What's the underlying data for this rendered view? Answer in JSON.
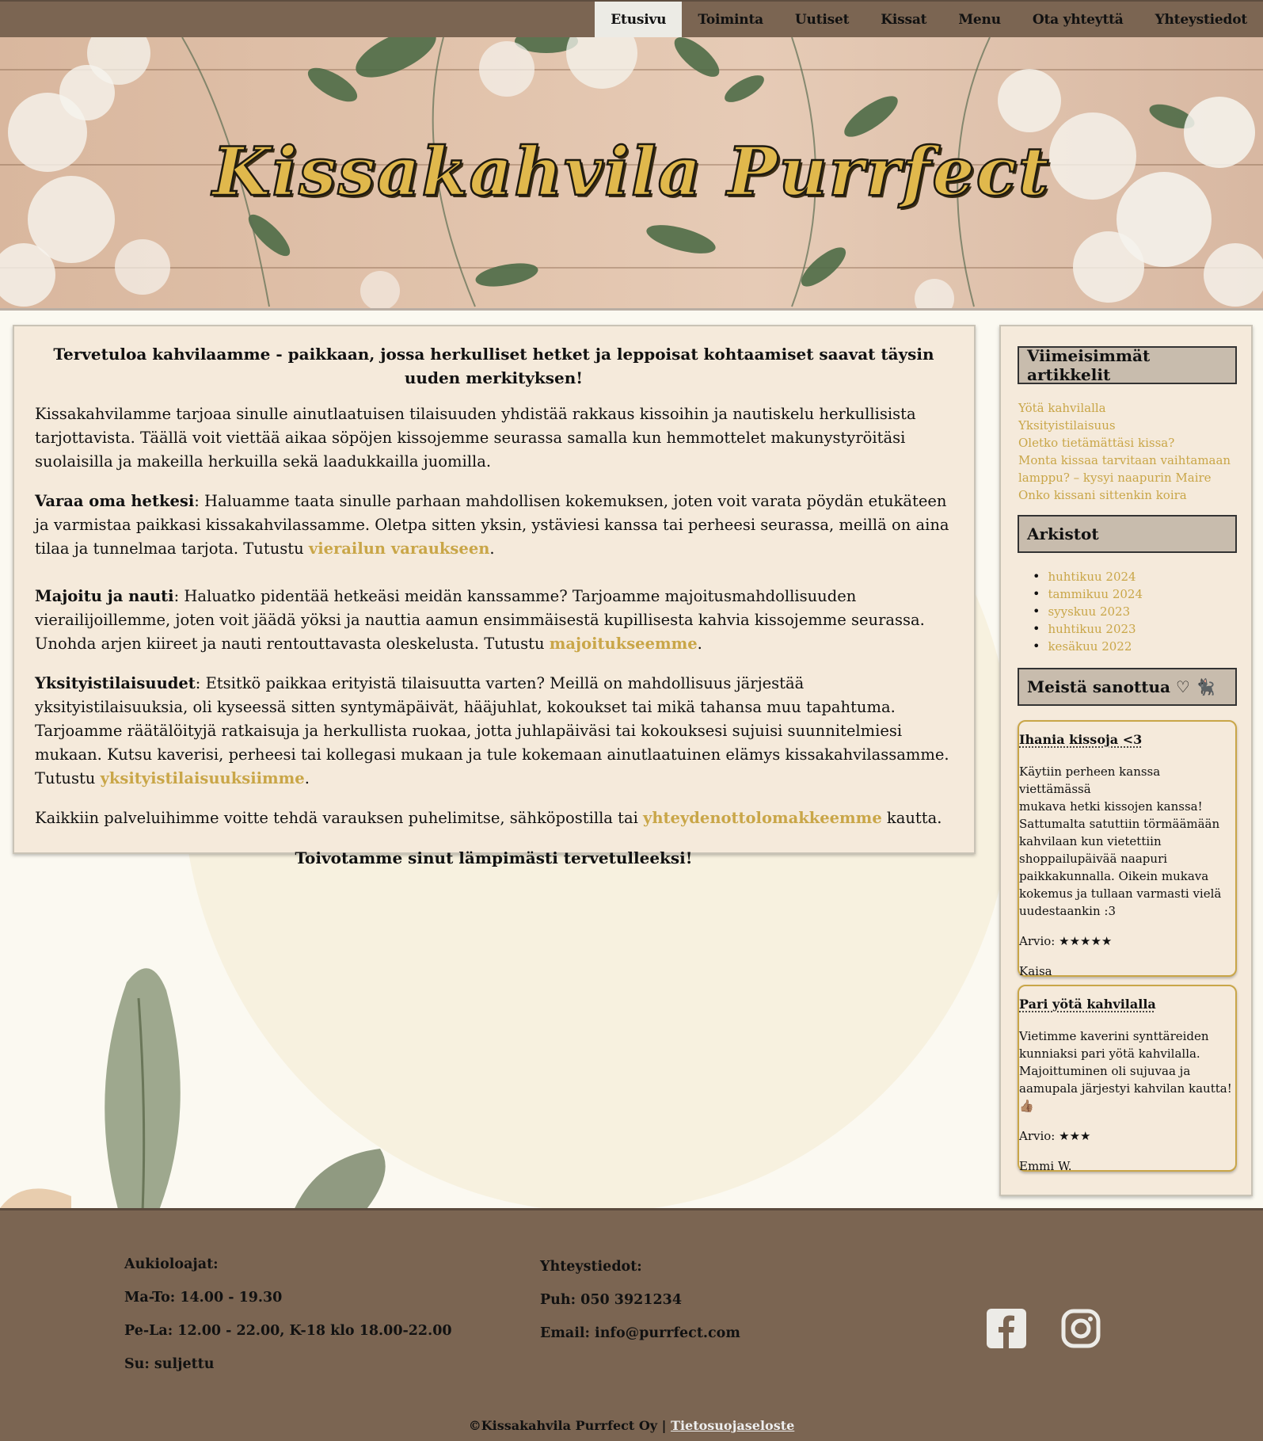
{
  "nav": {
    "items": [
      {
        "label": "Etusivu",
        "active": true
      },
      {
        "label": "Toiminta",
        "active": false
      },
      {
        "label": "Uutiset",
        "active": false
      },
      {
        "label": "Kissat",
        "active": false
      },
      {
        "label": "Menu",
        "active": false
      },
      {
        "label": "Ota yhteyttä",
        "active": false
      },
      {
        "label": "Yhteystiedot",
        "active": false
      }
    ]
  },
  "header": {
    "title": "Kissakahvila Purrfect"
  },
  "main": {
    "lead": "Tervetuloa kahvilaamme - paikkaan, jossa herkulliset hetket ja leppoisat kohtaamiset saavat täysin uuden merkityksen!",
    "intro": "Kissakahvilamme tarjoaa sinulle ainutlaatuisen tilaisuuden yhdistää rakkaus kissoihin ja nautiskelu herkullisista tarjottavista. Täällä voit viettää aikaa söpöjen kissojemme seurassa samalla kun hemmottelet makunystyröitäsi suolaisilla ja makeilla herkuilla sekä laadukkailla juomilla.",
    "book": {
      "heading": "Varaa oma hetkesi",
      "text": ": Haluamme taata sinulle parhaan mahdollisen kokemuksen, joten voit varata pöydän etukäteen ja varmistaa paikkasi kissakahvilassamme. Oletpa sitten yksin, ystäviesi kanssa tai perheesi seurassa, meillä on aina tilaa ja tunnelmaa tarjota. Tutustu ",
      "link": "vierailun varaukseen",
      "end": "."
    },
    "stay": {
      "heading": "Majoitu ja nauti",
      "text": ": Haluatko pidentää hetkeäsi meidän kanssamme? Tarjoamme majoitusmahdollisuuden vierailijoillemme, joten voit jäädä yöksi ja nauttia aamun ensimmäisestä kupillisesta kahvia kissojemme seurassa. Unohda arjen kiireet ja nauti rentouttavasta oleskelusta. Tutustu ",
      "link": "majoitukseemme",
      "end": "."
    },
    "events": {
      "heading": "Yksityistilaisuudet",
      "text": ": Etsitkö paikkaa erityistä tilaisuutta varten? Meillä on mahdollisuus järjestää yksityistilaisuuksia, oli kyseessä sitten syntymäpäivät, hääjuhlat, kokoukset tai mikä tahansa muu tapahtuma. Tarjoamme räätälöityjä ratkaisuja ja herkullista ruokaa, jotta juhlapäiväsi tai kokouksesi sujuisi suunnitelmiesi mukaan. Kutsu kaverisi, perheesi tai kollegasi mukaan ja tule kokemaan ainutlaatuinen elämys kissakahvilassamme. Tutustu ",
      "link": "yksityistilaisuuksiimme",
      "end": "."
    },
    "contact": {
      "text": "Kaikkiin palveluihimme voitte tehdä varauksen puhelimitse, sähköpostilla tai ",
      "link": "yhteydenottolomakkeemme",
      "end": " kautta."
    },
    "closing": "Toivotamme sinut lämpimästi tervetulleeksi!"
  },
  "sidebar": {
    "recent_heading": "Viimeisimmät artikkelit",
    "recent": [
      "Yötä kahvilalla",
      "Yksityistilaisuus",
      "Oletko tietämättäsi kissa?",
      "Monta kissaa tarvitaan vaihtamaan",
      "lamppu? – kysyi naapurin Maire",
      "Onko kissani sittenkin koira"
    ],
    "archive_heading": "Arkistot",
    "archive": [
      "huhtikuu 2024",
      "tammikuu 2024",
      "syyskuu 2023",
      "huhtikuu 2023",
      "kesäkuu 2022"
    ],
    "reviews_heading": "Meistä sanottua ♡ 🐈‍⬛",
    "reviews": [
      {
        "title": "Ihania kissoja <3",
        "lines": [
          "Käytiin perheen kanssa viettämässä",
          "mukava hetki kissojen kanssa!",
          "Sattumalta satuttiin törmäämään",
          "kahvilaan kun vietettiin",
          "shoppailupäivää naapuri",
          "paikkakunnalla. Oikein mukava",
          "kokemus ja tullaan varmasti vielä",
          "uudestaankin :3"
        ],
        "rating": "Arvio: ★★★★★",
        "author": "Kaisa"
      },
      {
        "title": "Pari yötä kahvilalla",
        "lines": [
          "Vietimme kaverini synttäreiden",
          "kunniaksi pari yötä kahvilalla.",
          "Majoittuminen oli sujuvaa ja",
          "aamupala järjestyi kahvilan kautta! 👍🏽"
        ],
        "rating": "Arvio: ★★★",
        "author": "Emmi W."
      }
    ]
  },
  "footer": {
    "hours": [
      "Aukioloajat:",
      "Ma-To: 14.00 - 19.30",
      "Pe-La: 12.00 - 22.00, K-18 klo 18.00-22.00",
      "Su: suljettu"
    ],
    "contact": [
      "Yhteystiedot:",
      "Puh: 050 3921234",
      "Email: info@purrfect.com"
    ],
    "copyright": "©Kissakahvila Purrfect Oy |",
    "privacy": "Tietosuojaseloste"
  },
  "colors": {
    "nav_bg": "#7b6552",
    "link": "#c9a648",
    "card_bg": "#f5eadb",
    "title_gold": "#e0b84c"
  },
  "icons": [
    "facebook-icon",
    "instagram-icon"
  ]
}
